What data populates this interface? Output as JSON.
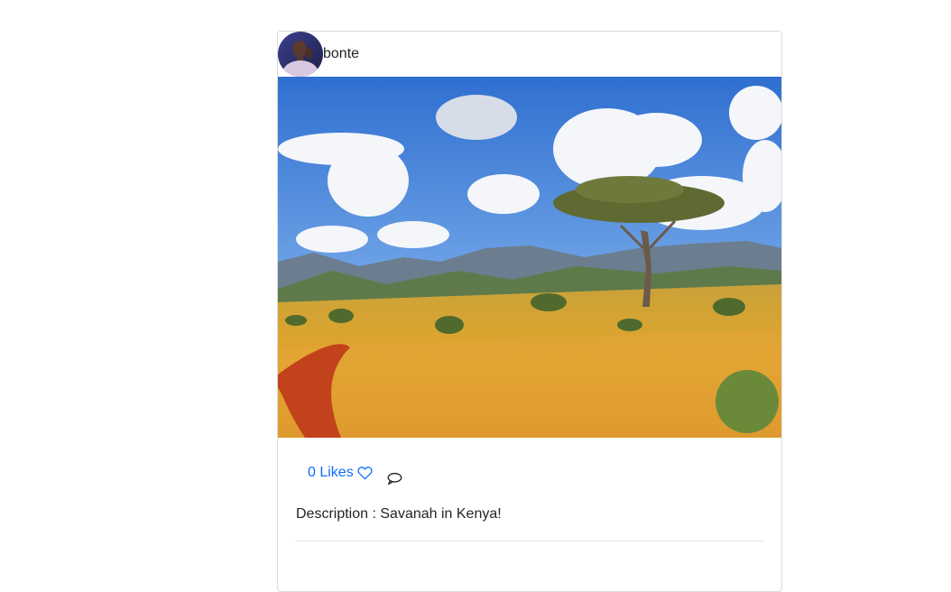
{
  "post": {
    "username": "bonte",
    "likes_label": "0 Likes",
    "description": "Description : Savanah in Kenya!"
  },
  "icons": {
    "heart": "heart-outline-icon",
    "comment": "speech-bubble-icon"
  },
  "colors": {
    "link": "#0d6efd",
    "border": "#dcdcdc",
    "divider": "#dee2e6"
  }
}
